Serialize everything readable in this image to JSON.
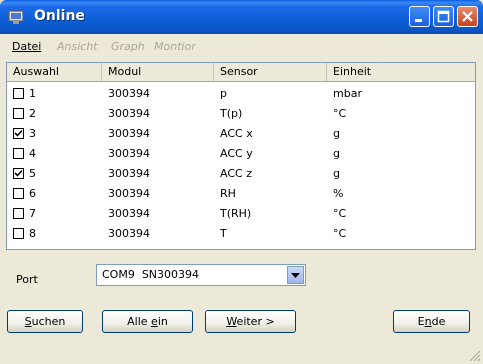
{
  "window": {
    "title": "Online",
    "icon": "app-icon"
  },
  "menu": [
    {
      "label": "Datei",
      "enabled": true
    },
    {
      "label": "Ansicht",
      "enabled": false
    },
    {
      "label": "Graph",
      "enabled": false
    },
    {
      "label": "Montior",
      "enabled": false
    }
  ],
  "table": {
    "columns": [
      "Auswahl",
      "Modul",
      "Sensor",
      "Einheit"
    ],
    "rows": [
      {
        "id": "1",
        "checked": false,
        "modul": "300394",
        "sensor": "p",
        "einheit": "mbar"
      },
      {
        "id": "2",
        "checked": false,
        "modul": "300394",
        "sensor": "T(p)",
        "einheit": "°C"
      },
      {
        "id": "3",
        "checked": true,
        "modul": "300394",
        "sensor": "ACC x",
        "einheit": "g"
      },
      {
        "id": "4",
        "checked": false,
        "modul": "300394",
        "sensor": "ACC y",
        "einheit": "g"
      },
      {
        "id": "5",
        "checked": true,
        "modul": "300394",
        "sensor": "ACC z",
        "einheit": "g"
      },
      {
        "id": "6",
        "checked": false,
        "modul": "300394",
        "sensor": "RH",
        "einheit": "%"
      },
      {
        "id": "7",
        "checked": false,
        "modul": "300394",
        "sensor": "T(RH)",
        "einheit": "°C"
      },
      {
        "id": "8",
        "checked": false,
        "modul": "300394",
        "sensor": "T",
        "einheit": "°C"
      }
    ]
  },
  "port": {
    "label": "Port",
    "selected": "COM9  SN300394"
  },
  "buttons": {
    "suchen": "Suchen",
    "alle_ein": "Alle ein",
    "weiter": "Weiter >",
    "ende": "Ende"
  },
  "colors": {
    "titlebar": "#0b55c4",
    "face": "#ece9d8",
    "close": "#c7431d"
  }
}
